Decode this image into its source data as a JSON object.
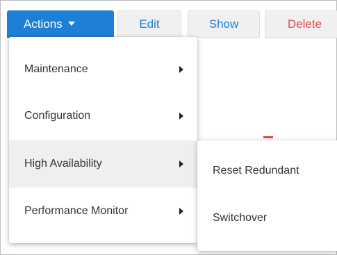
{
  "toolbar": {
    "actions_label": "Actions",
    "edit_label": "Edit",
    "show_label": "Show",
    "delete_label": "Delete"
  },
  "menu": {
    "items": [
      {
        "label": "Maintenance",
        "has_submenu": true
      },
      {
        "label": "Configuration",
        "has_submenu": true
      },
      {
        "label": "High Availability",
        "has_submenu": true,
        "active": true
      },
      {
        "label": "Performance Monitor",
        "has_submenu": true
      }
    ]
  },
  "submenu": {
    "items": [
      {
        "label": "Reset Redundant"
      },
      {
        "label": "Switchover"
      }
    ]
  },
  "colors": {
    "primary": "#1e7fd6",
    "danger": "#e54b4b",
    "active_bg": "#efefef"
  },
  "icons": {
    "caret": "caret-down-icon",
    "submenu_arrow": "chevron-right-icon"
  }
}
